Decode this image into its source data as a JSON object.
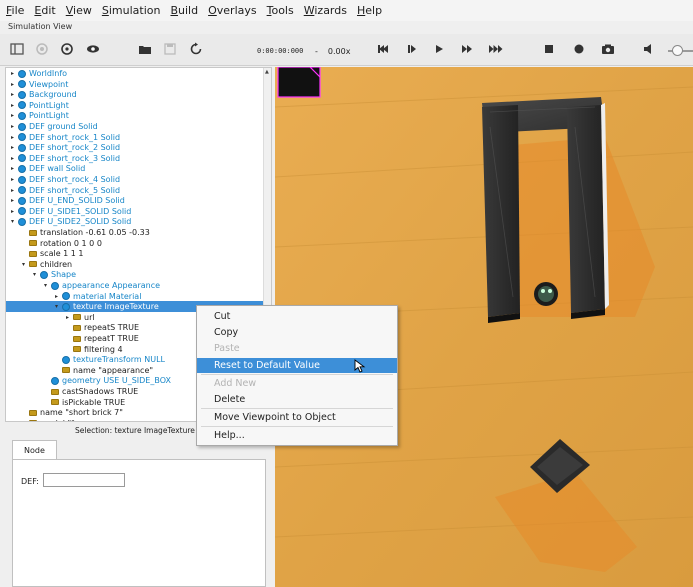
{
  "menubar": {
    "items": [
      {
        "label": "File"
      },
      {
        "label": "Edit"
      },
      {
        "label": "View"
      },
      {
        "label": "Simulation"
      },
      {
        "label": "Build"
      },
      {
        "label": "Overlays"
      },
      {
        "label": "Tools"
      },
      {
        "label": "Wizards"
      },
      {
        "label": "Help"
      }
    ]
  },
  "subtitle": "Simulation View",
  "toolbar": {
    "time": "0:00:00:000",
    "speed_sep": "-",
    "speed": "0.00x",
    "icons": [
      "layout-icon",
      "record-circle-icon",
      "camera-rotate-icon",
      "eye-icon",
      "open-folder-icon",
      "save-icon",
      "reload-icon",
      "step-back-icon",
      "step-icon",
      "play-icon",
      "fast-forward-icon",
      "fastest-icon",
      "stop-icon",
      "record-icon",
      "screenshot-icon",
      "volume-icon"
    ]
  },
  "scene_tree": {
    "rows": [
      {
        "label": "WorldInfo",
        "kind": "node",
        "indent": 0,
        "arrow": "▸"
      },
      {
        "label": "Viewpoint",
        "kind": "node",
        "indent": 0,
        "arrow": "▸"
      },
      {
        "label": "Background",
        "kind": "node",
        "indent": 0,
        "arrow": "▸"
      },
      {
        "label": "PointLight",
        "kind": "node",
        "indent": 0,
        "arrow": "▸"
      },
      {
        "label": "PointLight",
        "kind": "node",
        "indent": 0,
        "arrow": "▸"
      },
      {
        "label": "DEF ground Solid",
        "kind": "node",
        "indent": 0,
        "arrow": "▸"
      },
      {
        "label": "DEF short_rock_1 Solid",
        "kind": "node",
        "indent": 0,
        "arrow": "▸"
      },
      {
        "label": "DEF short_rock_2 Solid",
        "kind": "node",
        "indent": 0,
        "arrow": "▸"
      },
      {
        "label": "DEF short_rock_3 Solid",
        "kind": "node",
        "indent": 0,
        "arrow": "▸"
      },
      {
        "label": "DEF wall Solid",
        "kind": "node",
        "indent": 0,
        "arrow": "▸"
      },
      {
        "label": "DEF short_rock_4 Solid",
        "kind": "node",
        "indent": 0,
        "arrow": "▸"
      },
      {
        "label": "DEF short_rock_5 Solid",
        "kind": "node",
        "indent": 0,
        "arrow": "▸"
      },
      {
        "label": "DEF U_END_SOLID Solid",
        "kind": "node",
        "indent": 0,
        "arrow": "▸"
      },
      {
        "label": "DEF U_SIDE1_SOLID Solid",
        "kind": "node",
        "indent": 0,
        "arrow": "▸"
      },
      {
        "label": "DEF U_SIDE2_SOLID Solid",
        "kind": "node",
        "indent": 0,
        "arrow": "▾"
      },
      {
        "label": "translation -0.61 0.05 -0.33",
        "kind": "field",
        "indent": 1,
        "arrow": ""
      },
      {
        "label": "rotation 0 1 0 0",
        "kind": "field",
        "indent": 1,
        "arrow": ""
      },
      {
        "label": "scale 1 1 1",
        "kind": "field",
        "indent": 1,
        "arrow": ""
      },
      {
        "label": "children",
        "kind": "field",
        "indent": 1,
        "arrow": "▾"
      },
      {
        "label": "Shape",
        "kind": "node",
        "indent": 2,
        "arrow": "▾"
      },
      {
        "label": "appearance Appearance",
        "kind": "node",
        "indent": 3,
        "arrow": "▾"
      },
      {
        "label": "material Material",
        "kind": "node",
        "indent": 4,
        "arrow": "▸"
      },
      {
        "label": "texture ImageTexture",
        "kind": "node",
        "indent": 4,
        "arrow": "▾",
        "selected": true
      },
      {
        "label": "url",
        "kind": "field",
        "indent": 5,
        "arrow": "▸"
      },
      {
        "label": "repeatS TRUE",
        "kind": "field",
        "indent": 5,
        "arrow": ""
      },
      {
        "label": "repeatT TRUE",
        "kind": "field",
        "indent": 5,
        "arrow": ""
      },
      {
        "label": "filtering 4",
        "kind": "field",
        "indent": 5,
        "arrow": ""
      },
      {
        "label": "textureTransform NULL",
        "kind": "node",
        "indent": 4,
        "arrow": ""
      },
      {
        "label": "name \"appearance\"",
        "kind": "field",
        "indent": 4,
        "arrow": ""
      },
      {
        "label": "geometry USE U_SIDE_BOX",
        "kind": "node",
        "indent": 3,
        "arrow": ""
      },
      {
        "label": "castShadows TRUE",
        "kind": "field",
        "indent": 3,
        "arrow": ""
      },
      {
        "label": "isPickable TRUE",
        "kind": "field",
        "indent": 3,
        "arrow": ""
      },
      {
        "label": "name \"short brick 7\"",
        "kind": "field",
        "indent": 1,
        "arrow": ""
      },
      {
        "label": "model \"\"",
        "kind": "field",
        "indent": 1,
        "arrow": ""
      }
    ]
  },
  "selection_label": "Selection: texture ImageTexture",
  "editor": {
    "tab_label": "Node",
    "def_label": "DEF:",
    "def_value": ""
  },
  "context_menu": {
    "items": [
      {
        "label": "Cut",
        "state": "normal"
      },
      {
        "label": "Copy",
        "state": "normal"
      },
      {
        "label": "Paste",
        "state": "disabled"
      },
      {
        "label": "Reset to Default Value",
        "state": "highlight"
      },
      {
        "label": "Add New",
        "state": "disabled"
      },
      {
        "label": "Delete",
        "state": "normal"
      },
      {
        "label": "Move Viewpoint to Object",
        "state": "normal"
      },
      {
        "label": "Help...",
        "state": "normal"
      }
    ]
  },
  "colors": {
    "accent": "#3d8fd8",
    "node_blue": "#1786c8",
    "field_gold": "#c49a1c",
    "floor": "#e3a64a"
  }
}
